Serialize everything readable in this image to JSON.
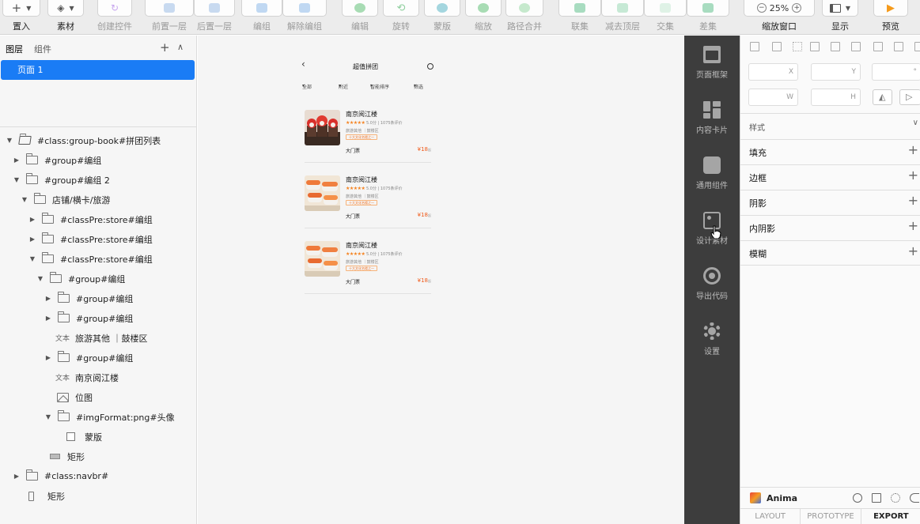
{
  "toolbar": {
    "insert": {
      "label": "置入",
      "icon": "plus-icon"
    },
    "assets": {
      "label": "素材",
      "icon": "layers-icon"
    },
    "create_control": {
      "label": "创建控件"
    },
    "bring_forward": {
      "label": "前置一层"
    },
    "send_backward": {
      "label": "后置一层"
    },
    "group": {
      "label": "编组"
    },
    "ungroup": {
      "label": "解除编组"
    },
    "edit": {
      "label": "编辑"
    },
    "rotate": {
      "label": "旋转"
    },
    "mask": {
      "label": "蒙版"
    },
    "scale": {
      "label": "缩放"
    },
    "path_merge": {
      "label": "路径合并"
    },
    "union": {
      "label": "联集"
    },
    "subtract": {
      "label": "减去顶层"
    },
    "intersect": {
      "label": "交集"
    },
    "difference": {
      "label": "差集"
    },
    "zoom": {
      "label": "缩放窗口",
      "value": "25%"
    },
    "display": {
      "label": "显示"
    },
    "preview": {
      "label": "预览"
    },
    "colors": {
      "green": "#5cc27a",
      "purple": "#b57be0",
      "blue": "#6aa8e8",
      "orange": "#f59a1b"
    }
  },
  "layers_panel": {
    "tabs": [
      "图层",
      "组件"
    ],
    "page": "页面 1",
    "tree": [
      {
        "label": "#class:group-book#拼团列表"
      },
      {
        "label": "#group#编组"
      },
      {
        "label": "#group#编组 2"
      },
      {
        "label": "店铺/横卡/旅游"
      },
      {
        "label": "#classPre:store#编组"
      },
      {
        "label": "#classPre:store#编组"
      },
      {
        "label": "#classPre:store#编组"
      },
      {
        "label": "#group#编组"
      },
      {
        "label": "#group#编组"
      },
      {
        "label": "#group#编组"
      },
      {
        "label": "旅游其他 ｜鼓楼区",
        "badge": "文本"
      },
      {
        "label": "#group#编组"
      },
      {
        "label": "南京阅江楼",
        "badge": "文本"
      },
      {
        "label": "位图"
      },
      {
        "label": "#imgFormat:png#头像"
      },
      {
        "label": "蒙版"
      },
      {
        "label": "矩形"
      },
      {
        "label": "#class:navbr#"
      },
      {
        "label": "矩形"
      }
    ]
  },
  "artboard": {
    "title": "超值拼团",
    "filters": [
      "全部",
      "附近",
      "智能排序",
      "筛选"
    ],
    "cards": [
      {
        "name": "南京阅江楼",
        "stars": "★★★★★",
        "score": "5.0分",
        "reviews": "1075条评价",
        "category": "旅游其他 ｜鼓楼区",
        "tag": "十大文化名楼之一",
        "ticket": "大门票",
        "price": "¥18",
        "price_suffix": "起",
        "image": "cake"
      },
      {
        "name": "南京阅江楼",
        "stars": "★★★★★",
        "score": "5.0分",
        "reviews": "1075条评价",
        "category": "旅游其他 ｜鼓楼区",
        "tag": "十大文化名楼之一",
        "ticket": "大门票",
        "price": "¥18",
        "price_suffix": "起",
        "image": "sushi"
      },
      {
        "name": "南京阅江楼",
        "stars": "★★★★★",
        "score": "5.0分",
        "reviews": "1075条评价",
        "category": "旅游其他 ｜鼓楼区",
        "tag": "十大文化名楼之一",
        "ticket": "大门票",
        "price": "¥18",
        "price_suffix": "起",
        "image": "sushi"
      }
    ],
    "colors": {
      "star": "#f5821f",
      "price": "#f05a1a"
    }
  },
  "plugin_sidebar": {
    "items": [
      {
        "label": "页面框架",
        "icon": "frame-icon"
      },
      {
        "label": "内容卡片",
        "icon": "cards-icon"
      },
      {
        "label": "通用组件",
        "icon": "puzzle-icon"
      },
      {
        "label": "设计素材",
        "icon": "image-icon"
      },
      {
        "label": "导出代码",
        "icon": "export-icon"
      },
      {
        "label": "设置",
        "icon": "gear-icon"
      }
    ]
  },
  "inspector": {
    "fields": {
      "x": "X",
      "y": "Y",
      "rotation": "°",
      "w": "W",
      "h": "H"
    },
    "style_label": "样式",
    "sections": [
      "填充",
      "边框",
      "阴影",
      "内阴影",
      "模糊"
    ],
    "anima": {
      "name": "Anima"
    },
    "bottom_tabs": [
      "LAYOUT",
      "PROTOTYPE",
      "EXPORT"
    ]
  }
}
